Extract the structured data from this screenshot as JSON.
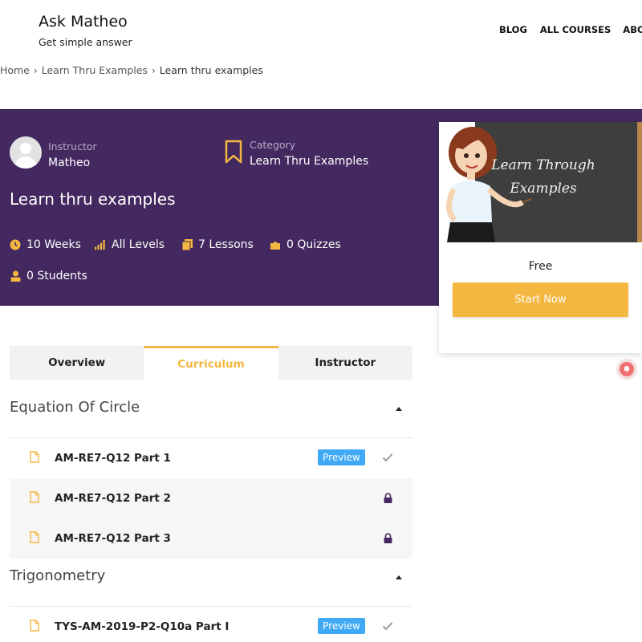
{
  "site": {
    "title": "Ask Matheo",
    "tagline": "Get simple answer"
  },
  "nav": {
    "items": [
      "BLOG",
      "ALL COURSES",
      "ABOUT"
    ]
  },
  "breadcrumb": {
    "items": [
      "Home",
      "Learn Thru Examples",
      "Learn thru examples"
    ]
  },
  "course": {
    "instructor_label": "Instructor",
    "instructor_name": "Matheo",
    "category_label": "Category",
    "category_name": "Learn Thru Examples",
    "title": "Learn thru examples",
    "stats": {
      "duration": "10 Weeks",
      "level": "All Levels",
      "lessons": "7 Lessons",
      "quizzes": "0 Quizzes",
      "students": "0 Students"
    }
  },
  "card": {
    "image_text_line1": "Learn Through",
    "image_text_line2": "Examples",
    "price": "Free",
    "start_button": "Start Now"
  },
  "tabs": [
    "Overview",
    "Curriculum",
    "Instructor"
  ],
  "curriculum": {
    "sections": [
      {
        "title": "Equation Of Circle",
        "lessons": [
          {
            "name": "AM-RE7-Q12 Part 1",
            "badge": "Preview"
          },
          {
            "name": "AM-RE7-Q12 Part 2"
          },
          {
            "name": "AM-RE7-Q12 Part 3"
          }
        ]
      },
      {
        "title": "Trigonometry",
        "lessons": [
          {
            "name": "TYS-AM-2019-P2-Q10a Part I",
            "badge": "Preview"
          }
        ]
      }
    ]
  },
  "colors": {
    "hero": "#43295f",
    "accent": "#f4b73f",
    "preview": "#3fa9f5"
  },
  "icons": [
    "clock-icon",
    "level-bars-icon",
    "lessons-icon",
    "puzzle-icon",
    "students-icon",
    "bookmark-icon",
    "doc-icon",
    "check-icon",
    "lock-icon"
  ]
}
